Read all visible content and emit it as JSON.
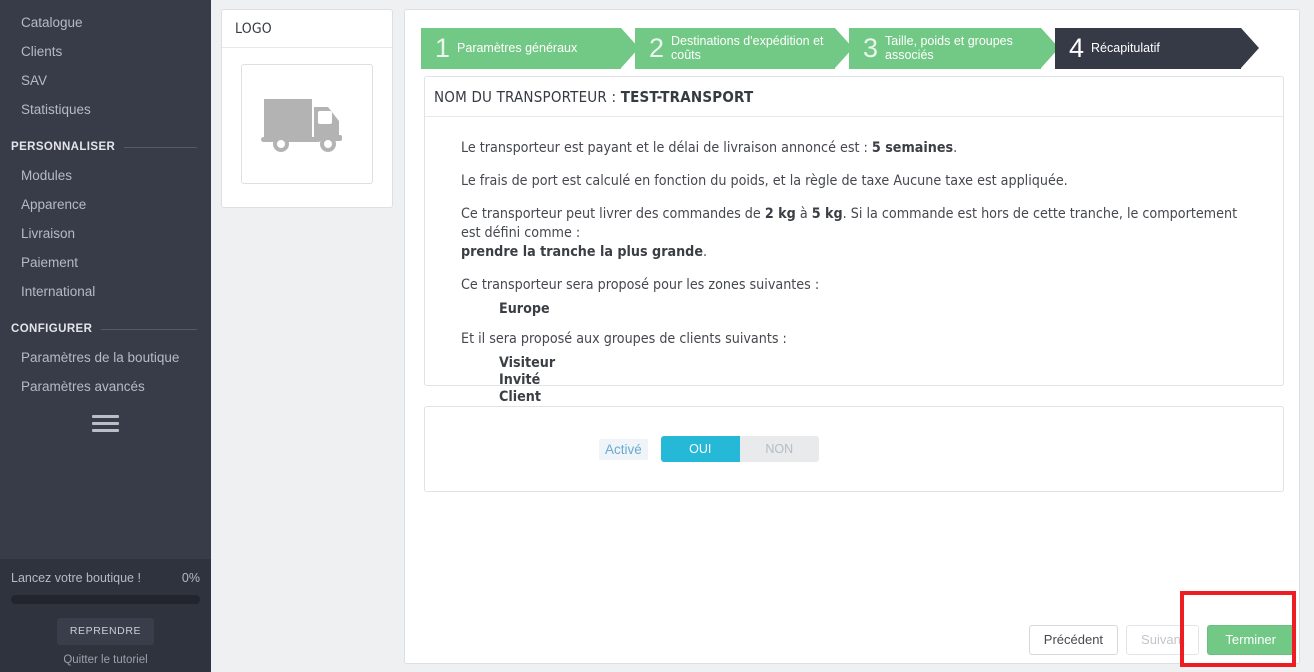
{
  "sidebar": {
    "nav_items": [
      {
        "label": "Catalogue",
        "name": "sidebar-item-catalogue"
      },
      {
        "label": "Clients",
        "name": "sidebar-item-clients"
      },
      {
        "label": "SAV",
        "name": "sidebar-item-sav"
      },
      {
        "label": "Statistiques",
        "name": "sidebar-item-statistiques"
      }
    ],
    "section_personnaliser": "PERSONNALISER",
    "personnaliser_items": [
      {
        "label": "Modules",
        "name": "sidebar-item-modules"
      },
      {
        "label": "Apparence",
        "name": "sidebar-item-apparence"
      },
      {
        "label": "Livraison",
        "name": "sidebar-item-livraison"
      },
      {
        "label": "Paiement",
        "name": "sidebar-item-paiement"
      },
      {
        "label": "International",
        "name": "sidebar-item-international"
      }
    ],
    "section_configurer": "CONFIGURER",
    "configurer_items": [
      {
        "label": "Paramètres de la boutique",
        "name": "sidebar-item-parametres-boutique"
      },
      {
        "label": "Paramètres avancés",
        "name": "sidebar-item-parametres-avances"
      }
    ],
    "footer": {
      "launch_label": "Lancez votre boutique !",
      "progress_percent": "0%",
      "progress_value": 0,
      "resume_label": "REPRENDRE",
      "quit_label": "Quitter le tutoriel"
    }
  },
  "logo_card": {
    "header": "LOGO",
    "icon": "delivery-truck-icon"
  },
  "wizard": {
    "steps": [
      {
        "num": "1",
        "label": "Paramètres généraux",
        "state": "done"
      },
      {
        "num": "2",
        "label": "Destinations d'expédition et coûts",
        "state": "done"
      },
      {
        "num": "3",
        "label": "Taille, poids et groupes associés",
        "state": "done"
      },
      {
        "num": "4",
        "label": "Récapitulatif",
        "state": "current"
      }
    ]
  },
  "summary": {
    "header_prefix": "NOM DU TRANSPORTEUR : ",
    "carrier_name": "TEST-TRANSPORT",
    "line1_a": "Le transporteur est payant et le délai de livraison annoncé est : ",
    "line1_b": "5 semaines",
    "line1_c": ".",
    "line2": "Le frais de port est calculé en fonction du poids, et la règle de taxe Aucune taxe est appliquée.",
    "line3_a": "Ce transporteur peut livrer des commandes de ",
    "line3_b": "2 kg",
    "line3_c": " à ",
    "line3_d": "5 kg",
    "line3_e": ". Si la commande est hors de cette tranche, le comportement est défini comme :",
    "line3_f": "prendre la tranche la plus grande",
    "line3_g": ".",
    "zones_intro": "Ce transporteur sera proposé pour les zones suivantes :",
    "zones": [
      "Europe"
    ],
    "groups_intro": "Et il sera proposé aux groupes de clients suivants :",
    "groups": [
      "Visiteur",
      "Invité",
      "Client"
    ]
  },
  "toggle": {
    "label": "Activé",
    "yes": "OUI",
    "no": "NON",
    "value": "OUI"
  },
  "actions": {
    "previous": "Précédent",
    "next": "Suivant",
    "finish": "Terminer"
  },
  "annotation": {
    "color": "#ee1c23",
    "target": "finish-button"
  },
  "colors": {
    "sidebar_bg": "#383c49",
    "page_bg": "#eff0f2",
    "step_done": "#72c885",
    "step_current": "#363a46",
    "toggle_on": "#25b9d7",
    "finish_green": "#72c885"
  }
}
